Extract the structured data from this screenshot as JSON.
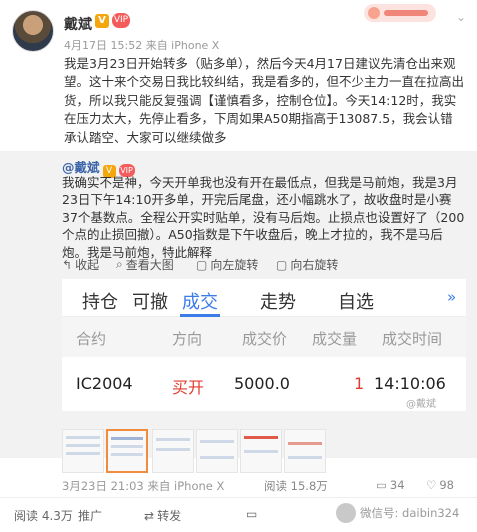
{
  "colors": {
    "link": "#3b64a8",
    "accent": "#3b7ce8",
    "buy": "#e23b2f",
    "muted": "#999999",
    "quote_bg": "#f2f2f2"
  },
  "post": {
    "username": "戴斌",
    "verified_badge": "V",
    "vip_badge": "VIP",
    "meta": "4月17日 15:52 来自 iPhone X",
    "text": "我是3月23日开始转多（贴多单），然后今天4月17日建议先清仓出来观望。这十来个交易日我比较纠结，我是看多的，但不少主力一直在拉高出货，所以我只能反复强调【谨慎看多，控制仓位】。今天14:12时，我实在压力太大，先停止看多，下周如果A50期指高于13087.5，我会认错承认踏空、大家可以继续做多"
  },
  "quoted": {
    "mention": "@戴斌",
    "text": "我确实不是神，今天开单我也没有开在最低点，但我是马前炮，我是3月23日下午14:10开多单，开完后尾盘，还小幅跳水了，故收盘时是小赛37个基数点。全程公开实时贴单，没有马后炮。止损点也设置好了（200个点的止损回撤）。A50指数是下午收盘后，晚上才拉的，我不是马后炮。我是马前炮，特此解释",
    "actions": {
      "collapse": "收起",
      "view_large": "查看大图",
      "rotate_left": "向左旋转",
      "rotate_right": "向右旋转"
    },
    "screenshot": {
      "tabs": [
        "持仓",
        "可撤",
        "成交",
        "走势",
        "自选"
      ],
      "more": "»",
      "headers": [
        "合约",
        "方向",
        "成交价",
        "成交量",
        "成交时间"
      ],
      "row": {
        "contract": "IC2004",
        "direction": "买开",
        "price": "5000.0",
        "volume": "1",
        "time": "14:10:06"
      },
      "watermark": "@戴斌"
    },
    "footer": {
      "meta": "3月23日 21:03 来自 iPhone X",
      "views": "阅读 15.8万",
      "comments": "34",
      "likes": "98"
    }
  },
  "bottom": {
    "views": "阅读 4.3万",
    "promote": "推广",
    "repost": "转发",
    "wechat": "微信号: daibin324"
  }
}
